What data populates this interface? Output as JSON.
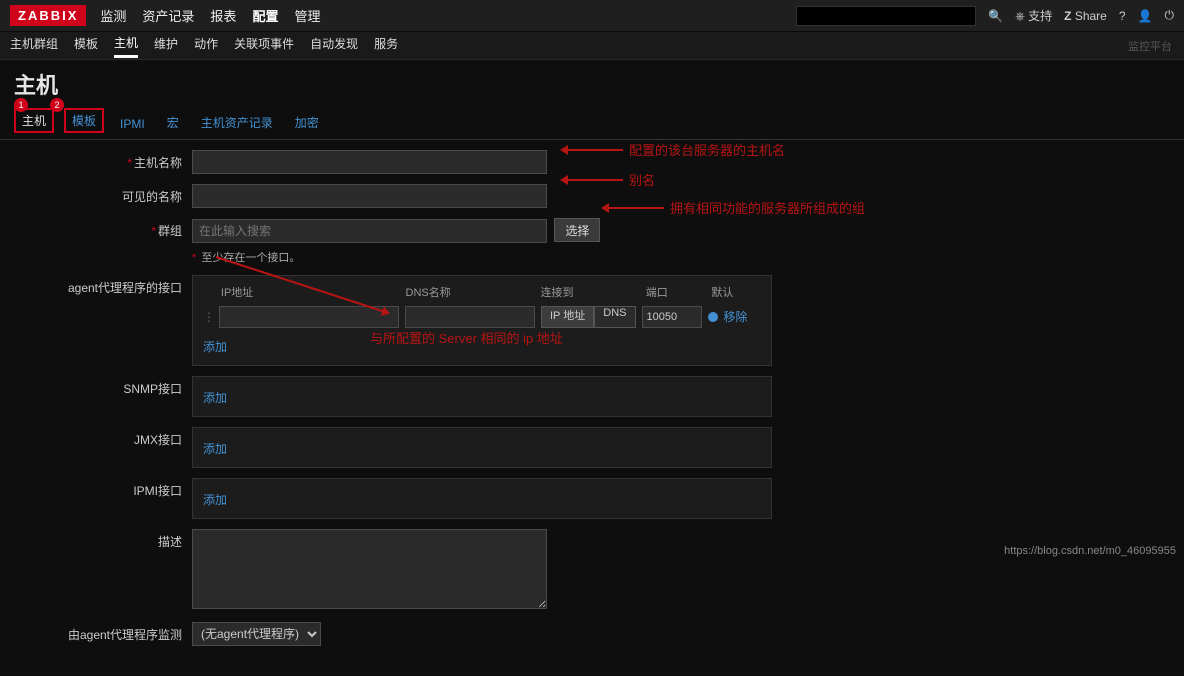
{
  "logo": "ZABBIX",
  "top_nav": [
    "监测",
    "资产记录",
    "报表",
    "配置",
    "管理"
  ],
  "top_nav_active": 3,
  "top_right": {
    "support": "支持",
    "share": "Share",
    "question": "?"
  },
  "sub_nav": [
    "主机群组",
    "模板",
    "主机",
    "维护",
    "动作",
    "关联项事件",
    "自动发现",
    "服务"
  ],
  "sub_nav_active": 2,
  "sub_nav_right": "监控平台",
  "page_title": "主机",
  "tabs": [
    "主机",
    "模板",
    "IPMI",
    "宏",
    "主机资产记录",
    "加密"
  ],
  "badges": [
    "1",
    "2"
  ],
  "form": {
    "host_name_label": "主机名称",
    "visible_name_label": "可见的名称",
    "groups_label": "群组",
    "groups_placeholder": "在此输入搜索",
    "select_btn": "选择",
    "groups_hint": "至少存在一个接口。",
    "agent_if_label": "agent代理程序的接口",
    "snmp_if_label": "SNMP接口",
    "jmx_if_label": "JMX接口",
    "ipmi_if_label": "IPMI接口",
    "desc_label": "描述",
    "monitored_by_label": "由agent代理程序监测",
    "monitored_by_value": "(无agent代理程序)",
    "iface_headers": {
      "ip": "IP地址",
      "dns": "DNS名称",
      "connect_to": "连接到",
      "port": "端口",
      "default": "默认"
    },
    "iface_row": {
      "seg_ip": "IP 地址",
      "seg_dns": "DNS",
      "port_value": "10050",
      "remove": "移除"
    },
    "add_link": "添加"
  },
  "annotations": {
    "a1": "配置的该台服务器的主机名",
    "a2": "别名",
    "a3": "拥有相同功能的服务器所组成的组",
    "a4": "与所配置的 Server 相同的 ip 地址"
  },
  "watermark": "https://blog.csdn.net/m0_46095955"
}
